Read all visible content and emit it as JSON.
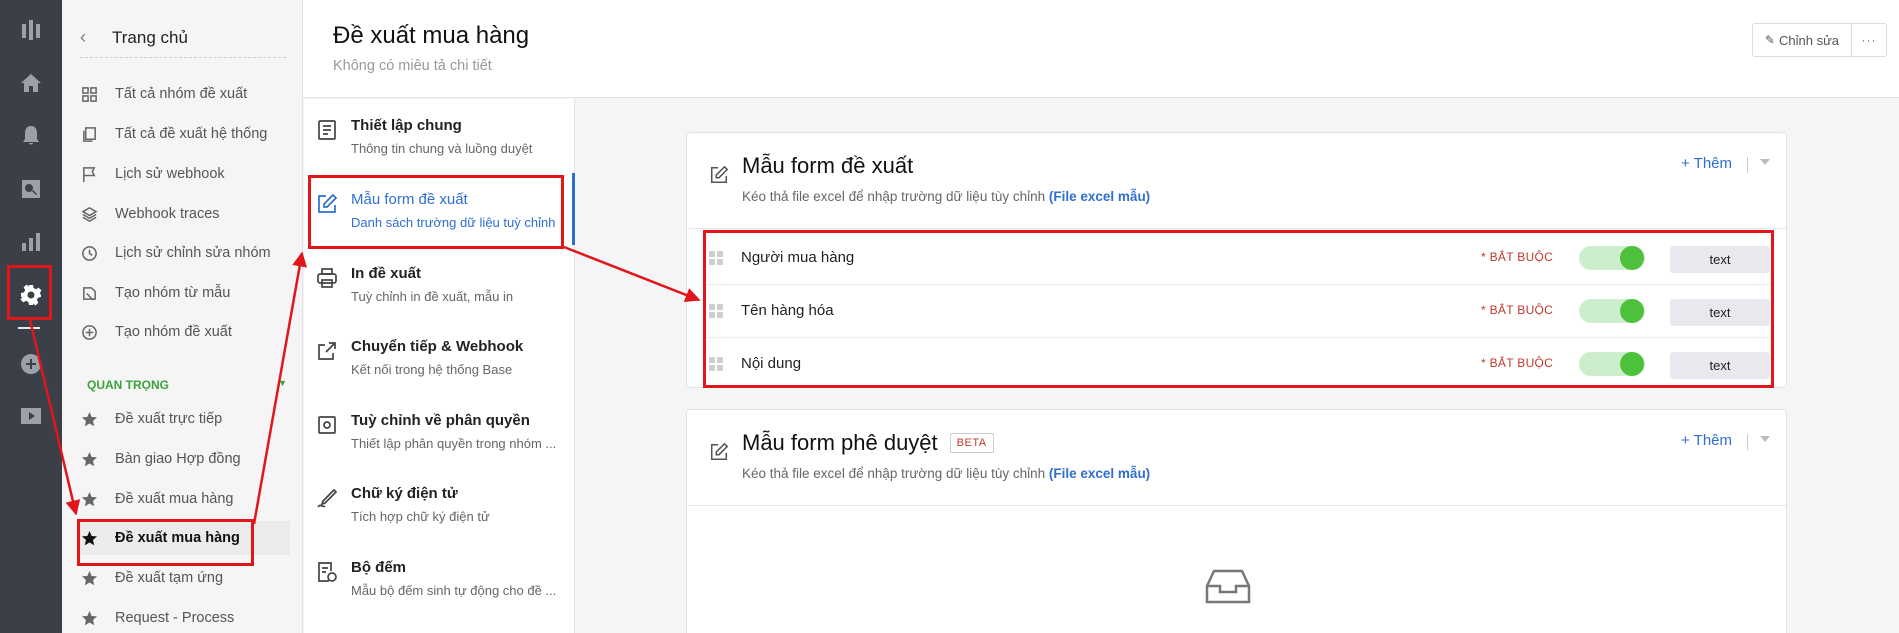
{
  "rail": {
    "icons": [
      "logo-icon",
      "home-icon",
      "bell-icon",
      "search-icon",
      "chart-icon",
      "settings-icon",
      "plus-icon",
      "play-icon"
    ]
  },
  "sidebar": {
    "title": "Trang chủ",
    "items": [
      {
        "label": "Tất cả nhóm đề xuất",
        "icon": "grid-icon"
      },
      {
        "label": "Tất cả đề xuất hệ thống",
        "icon": "copy-icon"
      },
      {
        "label": "Lịch sử webhook",
        "icon": "flag-icon"
      },
      {
        "label": "Webhook traces",
        "icon": "layers-icon"
      },
      {
        "label": "Lịch sử chỉnh sửa nhóm",
        "icon": "clock-icon"
      },
      {
        "label": "Tạo nhóm từ mẫu",
        "icon": "template-icon"
      },
      {
        "label": "Tạo nhóm đề xuất",
        "icon": "plus-circle-icon"
      }
    ],
    "section_label": "QUAN TRỌNG",
    "starred": [
      {
        "label": "Đề xuất trực tiếp"
      },
      {
        "label": "Bàn giao Hợp đồng"
      },
      {
        "label": "Đề xuất mua hàng"
      },
      {
        "label": "Đề xuất mua hàng",
        "active": true
      },
      {
        "label": "Đề xuất tạm ứng"
      },
      {
        "label": "Request - Process"
      }
    ]
  },
  "header": {
    "title": "Đề xuất mua hàng",
    "subtitle": "Không có miêu tả chi tiết",
    "edit_label": "Chỉnh sửa",
    "more_label": "···"
  },
  "settings_nav": [
    {
      "title": "Thiết lập chung",
      "desc": "Thông tin chung và luồng duyệt",
      "icon": "document-icon"
    },
    {
      "title": "Mẫu form đề xuất",
      "desc": "Danh sách trường dữ liệu tuỳ chỉnh",
      "icon": "edit-icon",
      "active": true
    },
    {
      "title": "In đề xuất",
      "desc": "Tuỳ chỉnh in đề xuất, mẫu in",
      "icon": "printer-icon"
    },
    {
      "title": "Chuyển tiếp & Webhook",
      "desc": "Kết nối trong hệ thống Base",
      "icon": "share-icon"
    },
    {
      "title": "Tuỳ chỉnh về phân quyền",
      "desc": "Thiết lập phân quyền trong nhóm ...",
      "icon": "permission-icon"
    },
    {
      "title": "Chữ ký điện tử",
      "desc": "Tích hợp chữ ký điện tử",
      "icon": "signature-icon"
    },
    {
      "title": "Bộ đếm",
      "desc": "Mẫu bộ đếm sinh tự động cho đề ...",
      "icon": "counter-icon"
    }
  ],
  "form_card": {
    "title": "Mẫu form đề xuất",
    "subtitle": "Kéo thả file excel để nhập trường dữ liệu tùy chỉnh",
    "link": "(File excel mẫu)",
    "add_label": "+ Thêm",
    "fields": [
      {
        "name": "Người mua hàng",
        "required": "* BẮT BUỘC",
        "type": "text",
        "enabled": true
      },
      {
        "name": "Tên hàng hóa",
        "required": "* BẮT BUỘC",
        "type": "text",
        "enabled": true
      },
      {
        "name": "Nội dung",
        "required": "* BẮT BUỘC",
        "type": "text",
        "enabled": true
      }
    ]
  },
  "approval_card": {
    "title": "Mẫu form phê duyệt",
    "badge": "BETA",
    "subtitle": "Kéo thả file excel để nhập trường dữ liệu tùy chỉnh",
    "link": "(File excel mẫu)",
    "add_label": "+ Thêm",
    "empty_icon": "inbox-icon"
  },
  "colors": {
    "accent": "#2f6fd0",
    "annotation": "#e0161b",
    "toggle_on": "#4ec13c",
    "required": "#c0392b",
    "rail": "#3b3f48"
  }
}
